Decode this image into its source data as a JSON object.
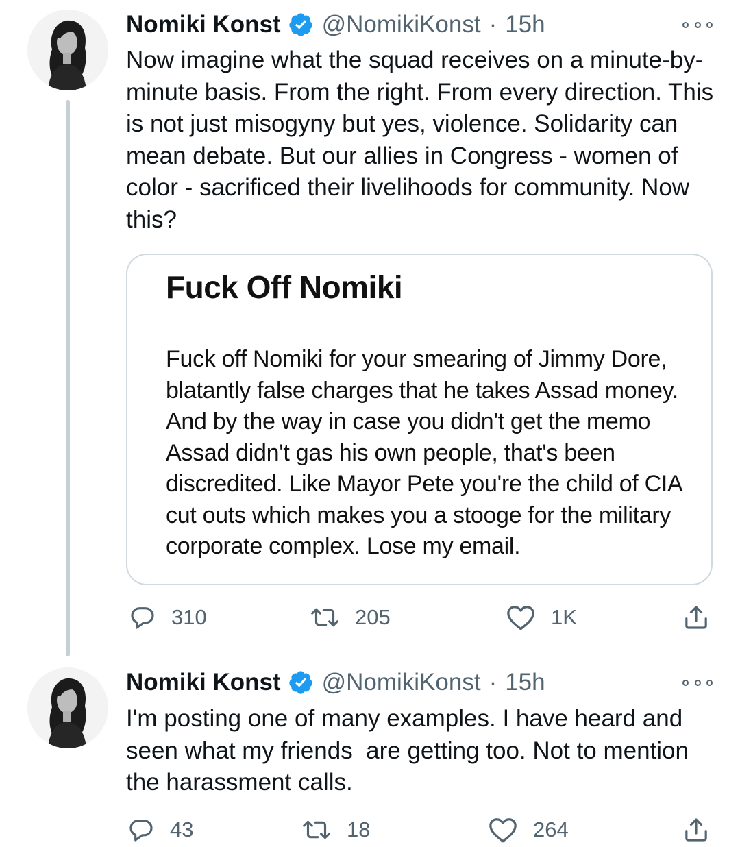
{
  "tweets": [
    {
      "author_name": "Nomiki Konst",
      "handle": "@NomikiKonst",
      "separator": "·",
      "time": "15h",
      "text": "Now imagine what the squad receives on a minute-by-minute basis. From the right. From every direction. This is not just misogyny but yes, violence. Solidarity can mean debate. But our allies in Congress - women of color - sacrificed their livelihoods for community. Now this?",
      "attachment": {
        "title": "Fuck Off Nomiki",
        "body": "Fuck off Nomiki for your smearing of Jimmy Dore, blatantly false charges that he takes Assad money. And by the way in case you didn't get the memo Assad didn't gas his own people, that's been discredited. Like Mayor Pete you're the child of CIA cut outs which makes you a stooge for the military corporate complex. Lose my email."
      },
      "replies": "310",
      "retweets": "205",
      "likes": "1K"
    },
    {
      "author_name": "Nomiki Konst",
      "handle": "@NomikiKonst",
      "separator": "·",
      "time": "15h",
      "text": "I'm posting one of many examples. I have heard and seen what my friends  are getting too. Not to mention the harassment calls.",
      "replies": "43",
      "retweets": "18",
      "likes": "264"
    }
  ],
  "icons": {
    "verified": "verified-badge-icon",
    "more": "more-options-icon",
    "reply": "reply-icon",
    "retweet": "retweet-icon",
    "like": "heart-icon",
    "share": "share-icon"
  },
  "colors": {
    "verified_blue": "#1d9bf0",
    "secondary_text": "#536471",
    "thread_line": "#c4cfd6",
    "card_border": "#cfd9de"
  }
}
